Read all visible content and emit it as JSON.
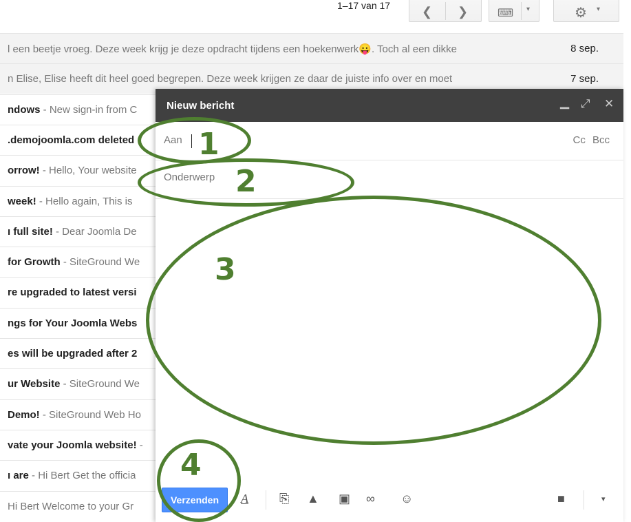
{
  "toolbar": {
    "pager_text": "1–17 van 17",
    "prev_icon": "chevron-left-icon",
    "next_icon": "chevron-right-icon",
    "keyboard_icon": "keyboard-icon",
    "settings_icon": "gear-icon"
  },
  "emails": [
    {
      "subject": "",
      "snippet": "l een beetje vroeg. Deze week krijg je deze opdracht tijdens een hoekenwerk😛. Toch al een dikke",
      "date": "8 sep.",
      "read": true
    },
    {
      "subject": "",
      "snippet": "n Elise, Elise heeft dit heel goed begrepen. Deze week krijgen ze daar de juiste info over en moet",
      "date": "7 sep.",
      "read": true
    },
    {
      "subject": "ndows",
      "snippet": " - New sign-in from C",
      "date": "",
      "read": false
    },
    {
      "subject": ".demojoomla.com deleted",
      "snippet": "",
      "date": "",
      "read": false
    },
    {
      "subject": "orrow!",
      "snippet": " - Hello, Your website",
      "date": "",
      "read": false
    },
    {
      "subject": "week!",
      "snippet": " - Hello again, This is",
      "date": "",
      "read": false
    },
    {
      "subject": "ı full site!",
      "snippet": " - Dear Joomla De",
      "date": "",
      "read": false
    },
    {
      "subject": "for Growth",
      "snippet": " - SiteGround We",
      "date": "",
      "read": false
    },
    {
      "subject": "re upgraded to latest versi",
      "snippet": "",
      "date": "",
      "read": false
    },
    {
      "subject": "ngs for Your Joomla Webs",
      "snippet": "",
      "date": "",
      "read": false
    },
    {
      "subject": "es will be upgraded after 2",
      "snippet": "",
      "date": "",
      "read": false
    },
    {
      "subject": "ur Website",
      "snippet": " - SiteGround We",
      "date": "",
      "read": false
    },
    {
      "subject": "Demo!",
      "snippet": " - SiteGround Web Ho",
      "date": "",
      "read": false
    },
    {
      "subject": "vate your Joomla website!",
      "snippet": " -",
      "date": "",
      "read": false
    },
    {
      "subject": "ı are",
      "snippet": " - Hi Bert Get the officia",
      "date": "",
      "read": false
    },
    {
      "subject": "",
      "snippet": "Hi Bert Welcome to your Gr",
      "date": "",
      "read": false
    }
  ],
  "compose": {
    "title": "Nieuw bericht",
    "minimize_icon": "minimize-icon",
    "expand_icon": "expand-icon",
    "close_icon": "close-icon",
    "to_label": "Aan",
    "to_value": "",
    "cc_bcc": "Cc Bcc",
    "subject_placeholder": "Onderwerp",
    "body": "",
    "send_label": "Verzenden",
    "toolbar_icons": [
      "format-text-icon",
      "attach-icon",
      "drive-icon",
      "photo-icon",
      "link-icon",
      "emoji-icon",
      "trash-icon",
      "more-options-icon"
    ]
  },
  "annotations": [
    "1",
    "2",
    "3",
    "4"
  ],
  "colors": {
    "annotation": "#4f7f30",
    "compose_header": "#404040",
    "send_button": "#4d90fe"
  }
}
